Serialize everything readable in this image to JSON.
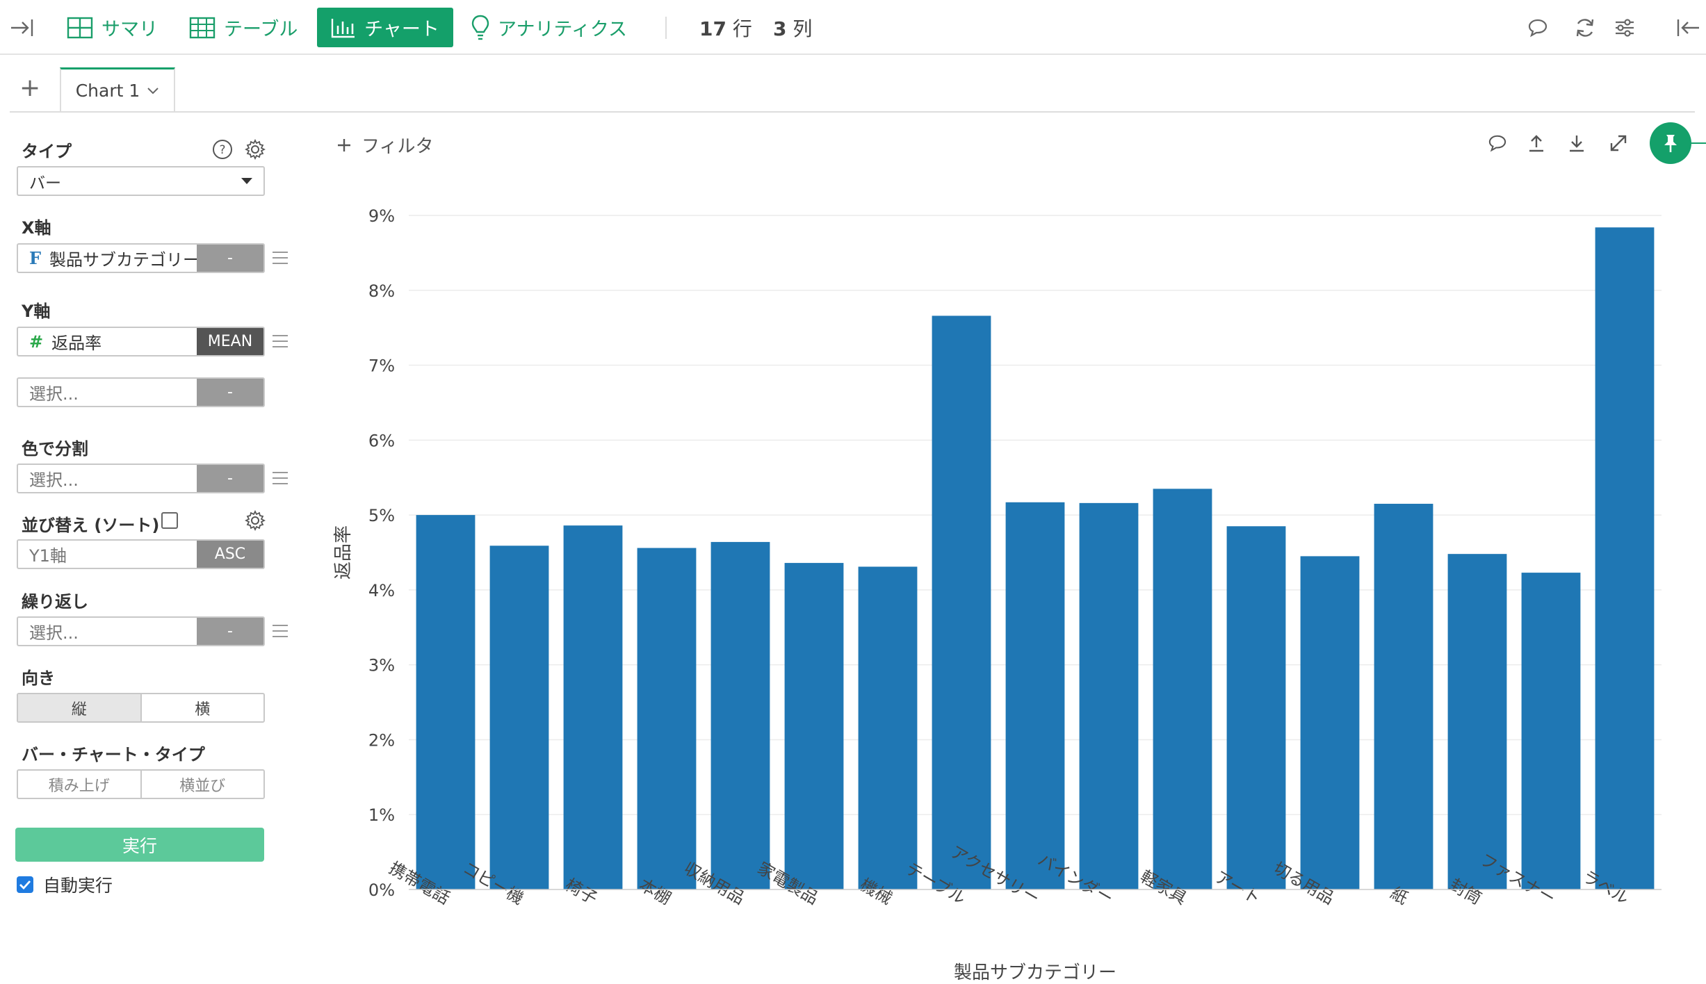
{
  "toolbar": {
    "summary_label": "サマリ",
    "table_label": "テーブル",
    "chart_label": "チャート",
    "analytics_label": "アナリティクス",
    "rows_count": "17",
    "rows_unit": "行",
    "cols_count": "3",
    "cols_unit": "列"
  },
  "tabs": {
    "add": "+",
    "active_label": "Chart 1"
  },
  "panel": {
    "type_label": "タイプ",
    "type_value": "バー",
    "x_label": "X軸",
    "x_type_glyph": "F",
    "x_value": "製品サブカテゴリー",
    "x_agg": "-",
    "y_label": "Y軸",
    "y_type_glyph": "#",
    "y_value": "返品率",
    "y_agg": "MEAN",
    "y2_placeholder": "選択...",
    "y2_agg": "-",
    "color_label": "色で分割",
    "color_placeholder": "選択...",
    "color_agg": "-",
    "sort_label": "並び替え (ソート)",
    "sort_placeholder": "Y1軸",
    "sort_order": "ASC",
    "repeat_label": "繰り返し",
    "repeat_placeholder": "選択...",
    "repeat_agg": "-",
    "orient_label": "向き",
    "orient_vertical": "縦",
    "orient_horizontal": "横",
    "bartype_label": "バー・チャート・タイプ",
    "bartype_stacked": "積み上げ",
    "bartype_side": "横並び",
    "run_label": "実行",
    "auto_run_label": "自動実行"
  },
  "chart_toolbar": {
    "filter_label": "フィルタ"
  },
  "colors": {
    "accent": "#14a06a",
    "bar": "#1f77b4"
  },
  "chart_data": {
    "type": "bar",
    "xlabel": "製品サブカテゴリー",
    "ylabel": "返品率",
    "ylim": [
      0,
      9
    ],
    "y_ticks": [
      "0%",
      "1%",
      "2%",
      "3%",
      "4%",
      "5%",
      "6%",
      "7%",
      "8%",
      "9%"
    ],
    "categories": [
      "携帯電話",
      "コピー機",
      "椅子",
      "本棚",
      "収納用品",
      "家電製品",
      "機械",
      "テーブル",
      "アクセサリー",
      "バインダー",
      "軽家具",
      "アート",
      "切る用品",
      "紙",
      "封筒",
      "ファスナー",
      "ラベル"
    ],
    "values": [
      5.0,
      4.59,
      4.86,
      4.56,
      4.64,
      4.36,
      4.31,
      7.66,
      5.17,
      5.16,
      5.35,
      4.85,
      4.45,
      5.15,
      4.48,
      4.23,
      8.84
    ],
    "grid": true,
    "legend": "none"
  }
}
